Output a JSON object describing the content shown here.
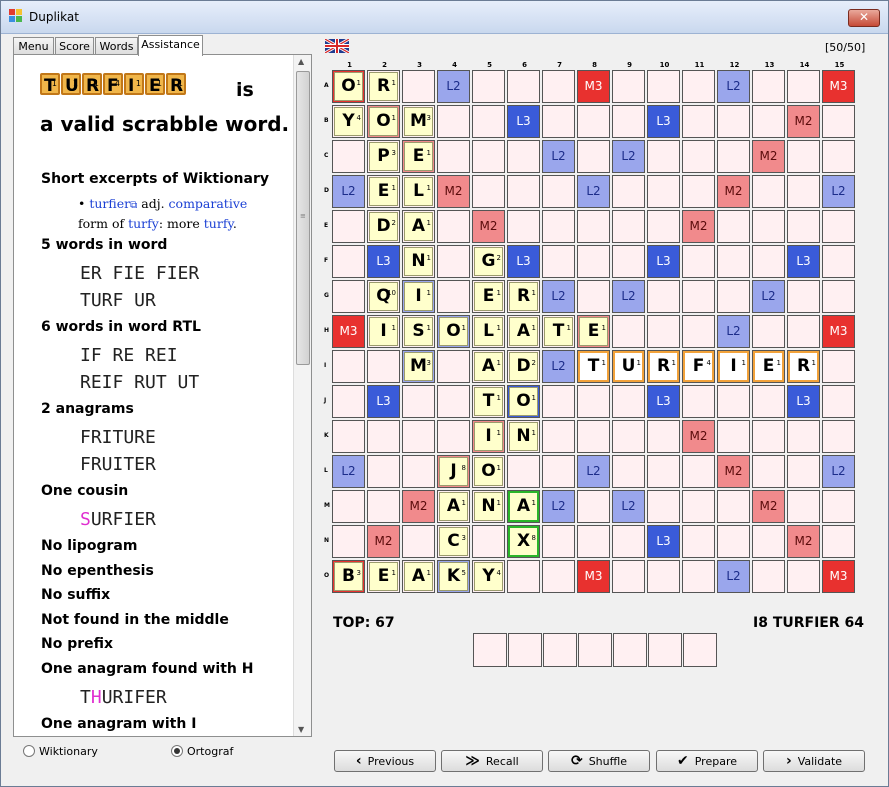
{
  "window": {
    "title": "Duplikat",
    "close_glyph": "✕"
  },
  "tabs": [
    {
      "label": "Menu"
    },
    {
      "label": "Score"
    },
    {
      "label": "Words"
    },
    {
      "label": "Assistance"
    }
  ],
  "assist": {
    "word_tiles": [
      {
        "l": "T",
        "v": "1"
      },
      {
        "l": "U",
        "v": "1"
      },
      {
        "l": "R",
        "v": "1"
      },
      {
        "l": "F",
        "v": "4"
      },
      {
        "l": "I",
        "v": "1"
      },
      {
        "l": "E",
        "v": "1"
      },
      {
        "l": "R",
        "v": "1"
      }
    ],
    "is": "is",
    "valid_text": "a valid scrabble word.",
    "wiktionary_heading": "Short excerpts of Wiktionary",
    "wik_bullet": "•",
    "wik_word": "turfier",
    "wik_pos": "adj.",
    "wik_comp": "comparative",
    "wik_form": "form of",
    "wik_turfy": "turfy",
    "wik_more": ": more",
    "wik_turfy2": "turfy",
    "wik_dot": ".",
    "s1_head": "5 words in word",
    "s1_line1": "ER FIE FIER",
    "s1_line2": "TURF UR",
    "s2_head": "6 words in word RTL",
    "s2_line1": "IF RE REI",
    "s2_line2": "REIF RUT UT",
    "s3_head": "2 anagrams",
    "s3_line1": "FRITURE",
    "s3_line2": "FRUITER",
    "s4_head": "One cousin",
    "cousin_hl": "S",
    "cousin_rest": "URFIER",
    "lipogram": "No lipogram",
    "epenthesis": "No epenthesis",
    "suffix": "No suffix",
    "middle": "Not found in the middle",
    "prefix": "No prefix",
    "anag_h_head": "One anagram found with H",
    "anag_h_pre": "T",
    "anag_h_hl": "H",
    "anag_h_post": "URIFER",
    "anag_i_head": "One anagram with I",
    "radio1": "Wiktionary",
    "radio2": "Ortograf",
    "radio_selected": "Ortograf"
  },
  "board": {
    "counter": "[50/50]",
    "columns": [
      "1",
      "2",
      "3",
      "4",
      "5",
      "6",
      "7",
      "8",
      "9",
      "10",
      "11",
      "12",
      "13",
      "14",
      "15"
    ],
    "rows": [
      "A",
      "B",
      "C",
      "D",
      "E",
      "F",
      "G",
      "H",
      "I",
      "J",
      "K",
      "L",
      "M",
      "N",
      "O"
    ],
    "premium_labels": {
      "tl": "L3",
      "dl": "L2",
      "dw": "M2",
      "tw": "M3"
    },
    "premiums": [
      "TW..DL...TW...DL..TW",
      ".DW...TL...TL...DW.",
      "..DW...DL.DL...DW..",
      "DL..DW...DL...DW..DL",
      "....DW.....DW....",
      ".TL...TL...TL...TL.",
      "..DL...DL.DL...DL..",
      "TW..DL...DW...DL..TW",
      "..DL...DL.DL...DL..",
      ".TL...TL...TL...TL.",
      "....DW.....DW....",
      "DL..DW...DL...DW..DL",
      "..DW...DL.DL...DW..",
      ".DW...TL...TL...DW.",
      "TW..DL...TW...DL..TW"
    ],
    "tiles": [
      {
        "r": 0,
        "c": 0,
        "l": "O",
        "v": "1"
      },
      {
        "r": 0,
        "c": 1,
        "l": "R",
        "v": "1"
      },
      {
        "r": 1,
        "c": 0,
        "l": "Y",
        "v": "4"
      },
      {
        "r": 1,
        "c": 1,
        "l": "O",
        "v": "1"
      },
      {
        "r": 1,
        "c": 2,
        "l": "M",
        "v": "3"
      },
      {
        "r": 2,
        "c": 1,
        "l": "P",
        "v": "3"
      },
      {
        "r": 2,
        "c": 2,
        "l": "E",
        "v": "1"
      },
      {
        "r": 3,
        "c": 1,
        "l": "E",
        "v": "1"
      },
      {
        "r": 3,
        "c": 2,
        "l": "L",
        "v": "1"
      },
      {
        "r": 4,
        "c": 1,
        "l": "D",
        "v": "2"
      },
      {
        "r": 4,
        "c": 2,
        "l": "A",
        "v": "1"
      },
      {
        "r": 5,
        "c": 2,
        "l": "N",
        "v": "1"
      },
      {
        "r": 5,
        "c": 4,
        "l": "G",
        "v": "2"
      },
      {
        "r": 6,
        "c": 1,
        "l": "Q",
        "v": "10"
      },
      {
        "r": 6,
        "c": 2,
        "l": "I",
        "v": "1"
      },
      {
        "r": 6,
        "c": 4,
        "l": "E",
        "v": "1"
      },
      {
        "r": 6,
        "c": 5,
        "l": "R",
        "v": "1"
      },
      {
        "r": 7,
        "c": 1,
        "l": "I",
        "v": "1"
      },
      {
        "r": 7,
        "c": 2,
        "l": "S",
        "v": "1"
      },
      {
        "r": 7,
        "c": 3,
        "l": "O",
        "v": "1"
      },
      {
        "r": 7,
        "c": 4,
        "l": "L",
        "v": "1"
      },
      {
        "r": 7,
        "c": 5,
        "l": "A",
        "v": "1"
      },
      {
        "r": 7,
        "c": 6,
        "l": "T",
        "v": "1"
      },
      {
        "r": 7,
        "c": 7,
        "l": "E",
        "v": "1"
      },
      {
        "r": 8,
        "c": 2,
        "l": "M",
        "v": "3"
      },
      {
        "r": 8,
        "c": 4,
        "l": "A",
        "v": "1"
      },
      {
        "r": 8,
        "c": 5,
        "l": "D",
        "v": "2"
      },
      {
        "r": 8,
        "c": 7,
        "l": "T",
        "v": "1",
        "n": 1
      },
      {
        "r": 8,
        "c": 8,
        "l": "U",
        "v": "1",
        "n": 1
      },
      {
        "r": 8,
        "c": 9,
        "l": "R",
        "v": "1",
        "n": 1
      },
      {
        "r": 8,
        "c": 10,
        "l": "F",
        "v": "4",
        "n": 1
      },
      {
        "r": 8,
        "c": 11,
        "l": "I",
        "v": "1",
        "n": 1
      },
      {
        "r": 8,
        "c": 12,
        "l": "E",
        "v": "1",
        "n": 1
      },
      {
        "r": 8,
        "c": 13,
        "l": "R",
        "v": "1",
        "n": 1
      },
      {
        "r": 9,
        "c": 4,
        "l": "T",
        "v": "1"
      },
      {
        "r": 9,
        "c": 5,
        "l": "O",
        "v": "1"
      },
      {
        "r": 10,
        "c": 4,
        "l": "I",
        "v": "1"
      },
      {
        "r": 10,
        "c": 5,
        "l": "N",
        "v": "1"
      },
      {
        "r": 11,
        "c": 3,
        "l": "J",
        "v": "8"
      },
      {
        "r": 11,
        "c": 4,
        "l": "O",
        "v": "1"
      },
      {
        "r": 12,
        "c": 3,
        "l": "A",
        "v": "1"
      },
      {
        "r": 12,
        "c": 4,
        "l": "N",
        "v": "1"
      },
      {
        "r": 12,
        "c": 5,
        "l": "A",
        "v": "1",
        "last": 1
      },
      {
        "r": 13,
        "c": 3,
        "l": "C",
        "v": "3"
      },
      {
        "r": 13,
        "c": 5,
        "l": "X",
        "v": "8",
        "last": 1
      },
      {
        "r": 14,
        "c": 0,
        "l": "B",
        "v": "3"
      },
      {
        "r": 14,
        "c": 1,
        "l": "E",
        "v": "1"
      },
      {
        "r": 14,
        "c": 2,
        "l": "A",
        "v": "1"
      },
      {
        "r": 14,
        "c": 3,
        "l": "K",
        "v": "5"
      },
      {
        "r": 14,
        "c": 4,
        "l": "Y",
        "v": "4"
      }
    ]
  },
  "status": {
    "top": "TOP: 67",
    "best": "I8 TURFIER 64"
  },
  "buttons": [
    {
      "label": "Previous",
      "icon": "‹"
    },
    {
      "label": "Recall",
      "icon": "≫"
    },
    {
      "label": "Shuffle",
      "icon": "⟳"
    },
    {
      "label": "Prepare",
      "icon": "✔"
    },
    {
      "label": "Validate",
      "icon": "›"
    }
  ],
  "icons": {
    "flag": "uk-flag-icon",
    "external": "external-link-icon"
  }
}
